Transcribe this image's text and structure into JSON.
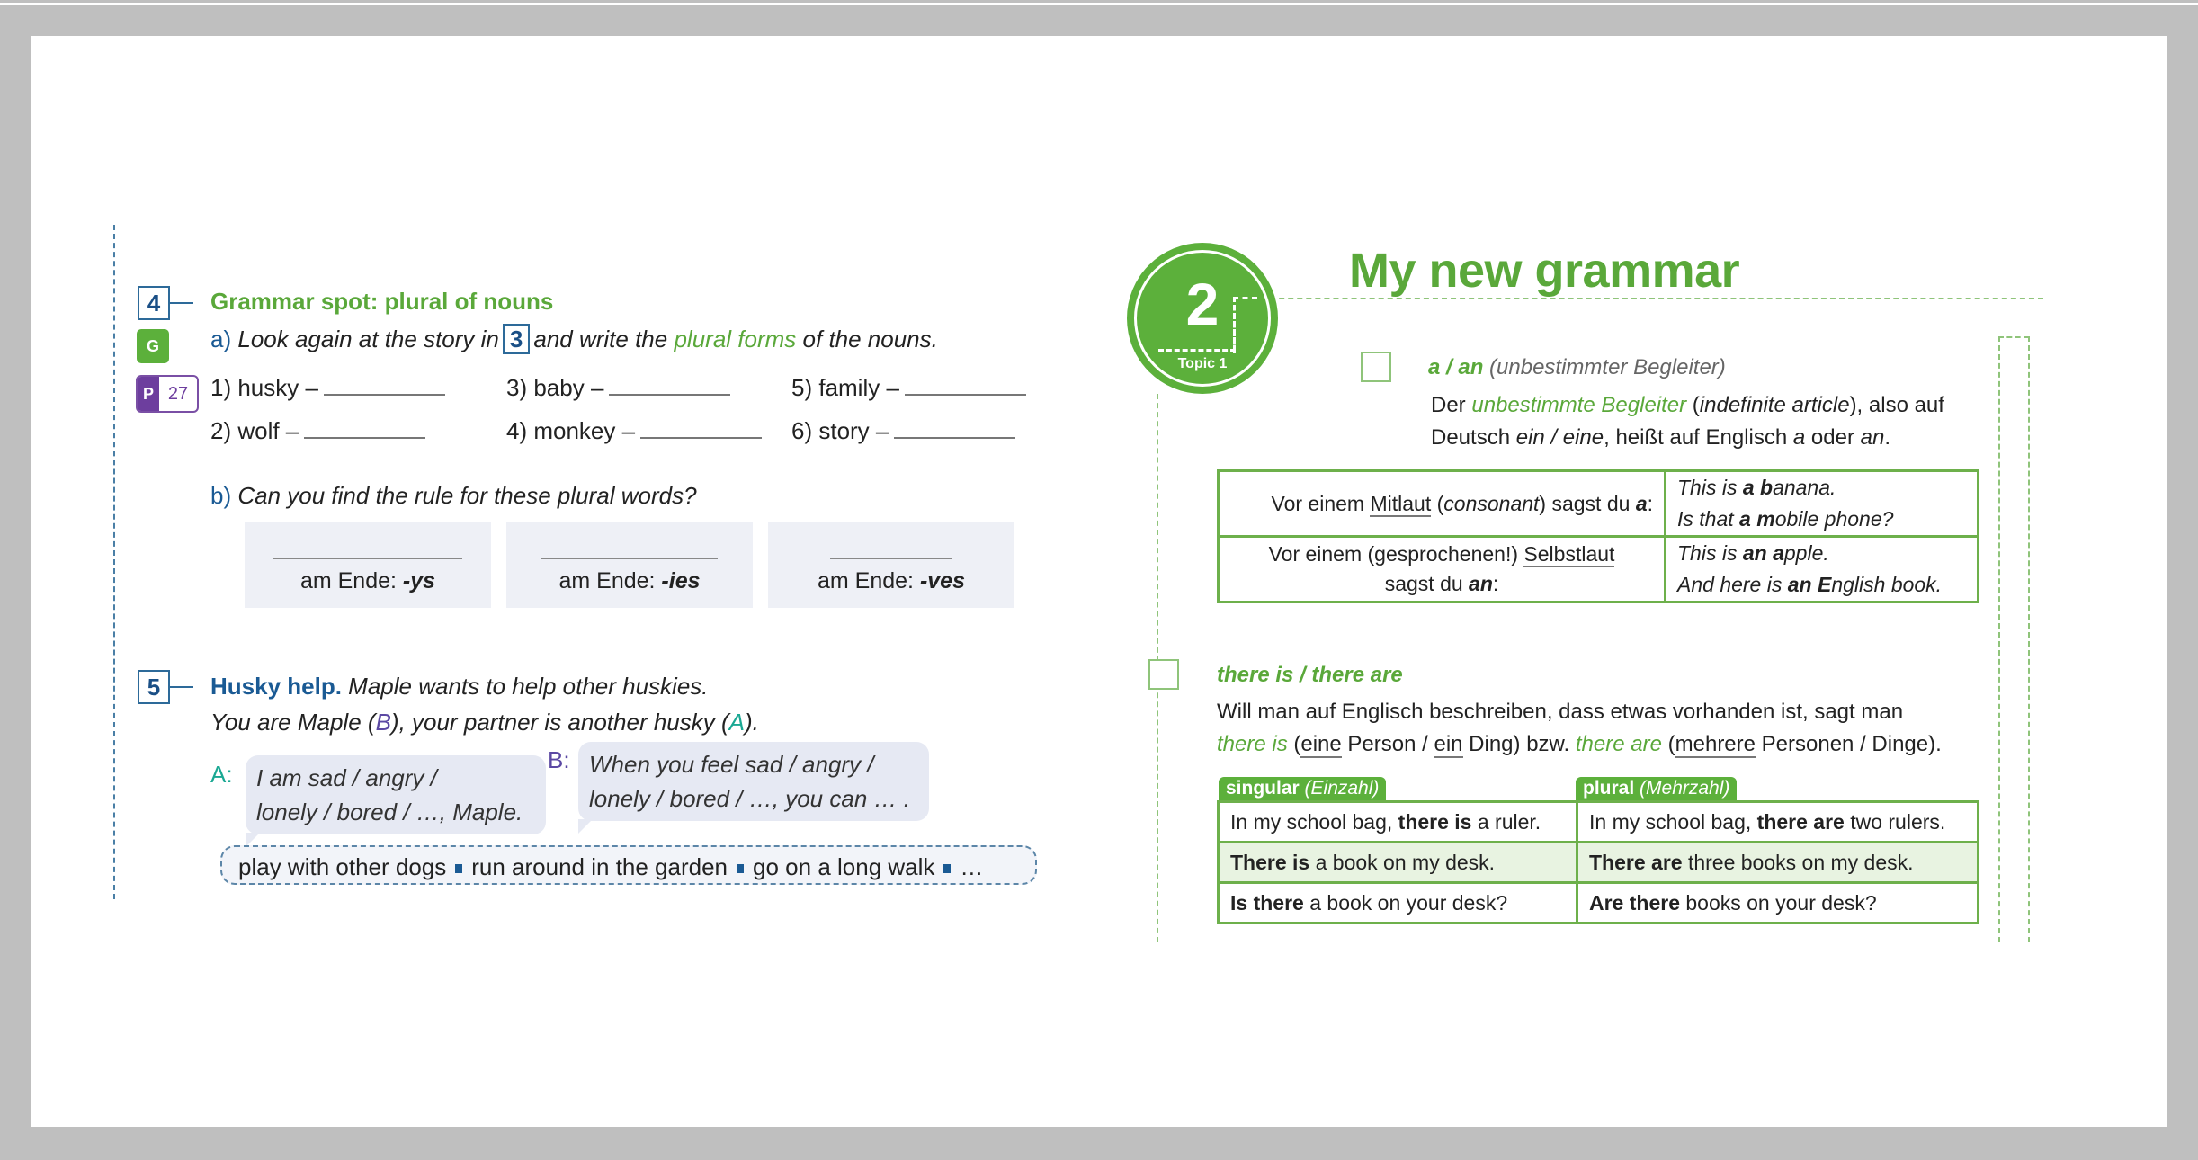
{
  "left_page": {
    "exercise4": {
      "number": "4",
      "title": "Grammar spot: plural of nouns",
      "badge_g": "G",
      "badge_p": "P",
      "badge_page": "27",
      "part_a": {
        "label": "a)",
        "instruction_1": "Look again at the story in",
        "ref_box": "3",
        "instruction_2": "and write the",
        "instruction_green": "plural forms",
        "instruction_3": "of the nouns."
      },
      "items": [
        {
          "label": "1) husky –"
        },
        {
          "label": "3) baby –"
        },
        {
          "label": "5) family –"
        },
        {
          "label": "2) wolf –"
        },
        {
          "label": "4) monkey –"
        },
        {
          "label": "6) story –"
        }
      ],
      "part_b": {
        "label": "b)",
        "instruction": "Can you find the rule for these plural words?",
        "rules": [
          {
            "prefix": "am Ende: ",
            "ending": "-ys"
          },
          {
            "prefix": "am Ende: ",
            "ending": "-ies"
          },
          {
            "prefix": "am Ende: ",
            "ending": "-ves"
          }
        ]
      }
    },
    "exercise5": {
      "number": "5",
      "title": "Husky help.",
      "intro": "Maple wants to help other huskies.",
      "line2_a": "You are Maple (",
      "line2_b": "B",
      "line2_c": "), your partner is another husky (",
      "line2_d": "A",
      "line2_e": ").",
      "speaker_a": "A:",
      "bubble_a_1": "I am sad / angry /",
      "bubble_a_2": "lonely / bored / …, Maple.",
      "speaker_b": "B:",
      "bubble_b_1": "When you feel sad / angry /",
      "bubble_b_2": "lonely / bored / …, you can … .",
      "chips": [
        "play with other dogs",
        "run around in the garden",
        "go on a long walk",
        "…"
      ]
    }
  },
  "right_page": {
    "topic_number": "2",
    "topic_label": "Topic 1",
    "title": "My new grammar",
    "section1": {
      "title_green": "a / an",
      "title_rest": " (unbestimmter Begleiter)",
      "line1_a": "Der ",
      "line1_green": "unbestimmte Begleiter",
      "line1_b": " (",
      "line1_it": "indefinite article",
      "line1_c": "), also auf",
      "line2_a": "Deutsch ",
      "line2_it1": "ein / eine",
      "line2_b": ", heißt auf Englisch ",
      "line2_it2": "a",
      "line2_c": " oder ",
      "line2_it3": "an",
      "line2_d": ".",
      "table": [
        {
          "rule_a": "Vor einem ",
          "rule_ul": "Mitlaut",
          "rule_b": " (",
          "rule_it": "consonant",
          "rule_c": ") sagst du ",
          "rule_bold": "a",
          "rule_d": ":",
          "ex1_a": "This is ",
          "ex1_b": "a b",
          "ex1_c": "anana.",
          "ex2_a": "Is that ",
          "ex2_b": "a m",
          "ex2_c": "obile phone?"
        },
        {
          "rule_a": "Vor einem (gesprochenen!) ",
          "rule_ul": "Selbstlaut",
          "rule_line2a": "sagst du ",
          "rule_bold": "an",
          "rule_line2b": ":",
          "ex1_a": "This is ",
          "ex1_b": "an a",
          "ex1_c": "pple.",
          "ex2_a": "And here is ",
          "ex2_b": "an E",
          "ex2_c": "nglish book."
        }
      ]
    },
    "section2": {
      "title": "there is / there are",
      "line1": "Will man auf Englisch beschreiben, dass etwas vorhanden ist, sagt man",
      "line2_g1": "there is",
      "line2_a": " (",
      "line2_u1": "eine",
      "line2_b": " Person / ",
      "line2_u2": "ein",
      "line2_c": " Ding) bzw. ",
      "line2_g2": "there are",
      "line2_d": " (",
      "line2_u3": "mehrere",
      "line2_e": " Personen / Dinge).",
      "tab_singular": "singular",
      "tab_singular_de": "(Einzahl)",
      "tab_plural": "plural",
      "tab_plural_de": "(Mehrzahl)",
      "rows": [
        {
          "s_a": "In my school bag, ",
          "s_b": "there is",
          "s_c": " a ruler.",
          "p_a": "In my school bag, ",
          "p_b": "there are",
          "p_c": " two rulers."
        },
        {
          "s_a": "",
          "s_b": "There is",
          "s_c": " a book on my desk.",
          "p_a": "",
          "p_b": "There are",
          "p_c": " three books on my desk."
        },
        {
          "s_a": "",
          "s_b": "Is there",
          "s_c": " a book on your desk?",
          "p_a": "",
          "p_b": "Are there",
          "p_c": " books on your desk?"
        }
      ]
    }
  },
  "colors": {
    "green": "#5aa83a",
    "blue": "#1a5a94",
    "purple": "#6d3e9e",
    "teal": "#1aa893",
    "frame_gray": "#bfbfbf"
  }
}
